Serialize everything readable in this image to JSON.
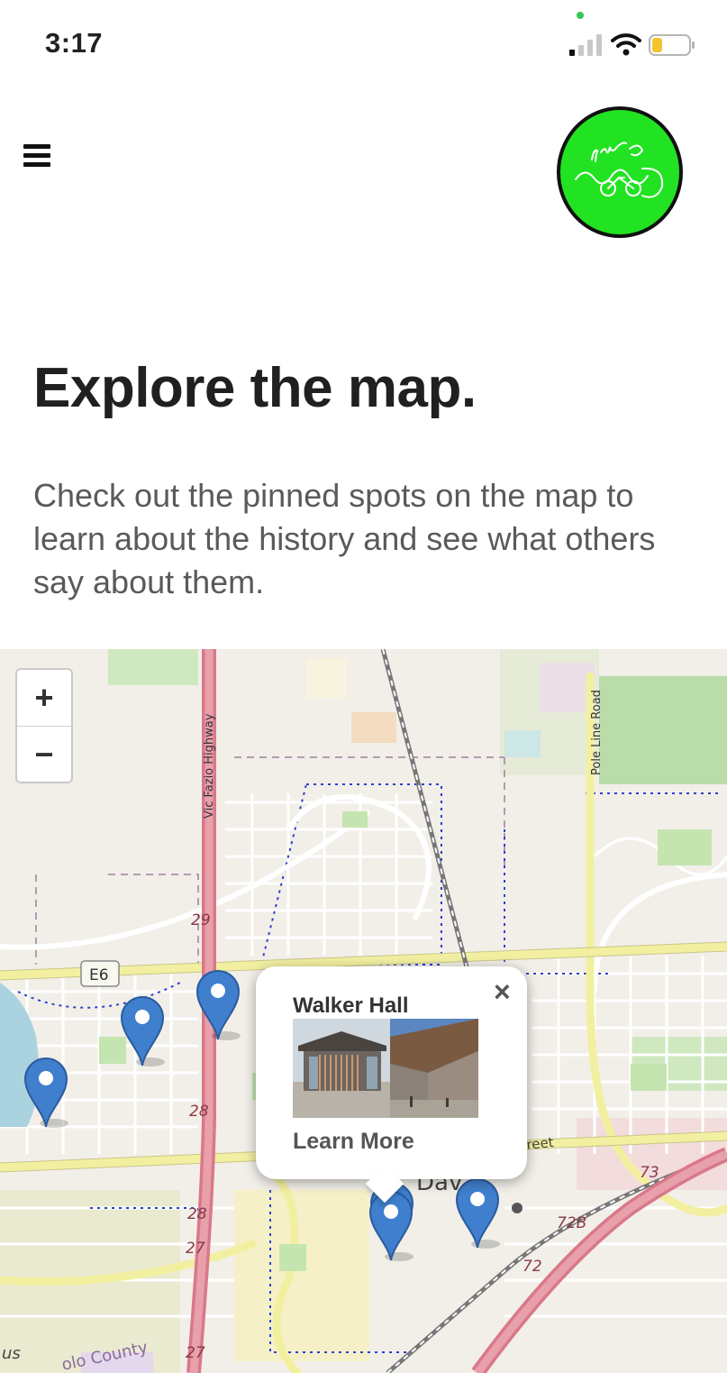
{
  "status_bar": {
    "time": "3:17"
  },
  "header": {
    "menu_icon": "hamburger-menu-icon",
    "logo": {
      "icon": "in-the-loop-logo",
      "text": "in the LOOP",
      "color": "#22e322"
    }
  },
  "main": {
    "title": "Explore the map.",
    "intro": "Check out the pinned spots on the map to learn about the history and see what others say about them."
  },
  "map": {
    "zoom_in_label": "+",
    "zoom_out_label": "−",
    "labels": {
      "highway": "Vic Fazio Highway",
      "pole_line": "Pole Line Road",
      "e6": "E6",
      "r29": "29",
      "r28a": "28",
      "r28b": "28",
      "r27a": "27",
      "r27b": "27",
      "r73": "73",
      "r72b": "72B",
      "r72": "72",
      "davis": "Dav",
      "street": "reet",
      "county": "olo County",
      "us": "us"
    },
    "marker_color": "#3f7fcd",
    "popup": {
      "title": "Walker Hall",
      "close_label": "×",
      "link_label": "Learn More"
    }
  }
}
